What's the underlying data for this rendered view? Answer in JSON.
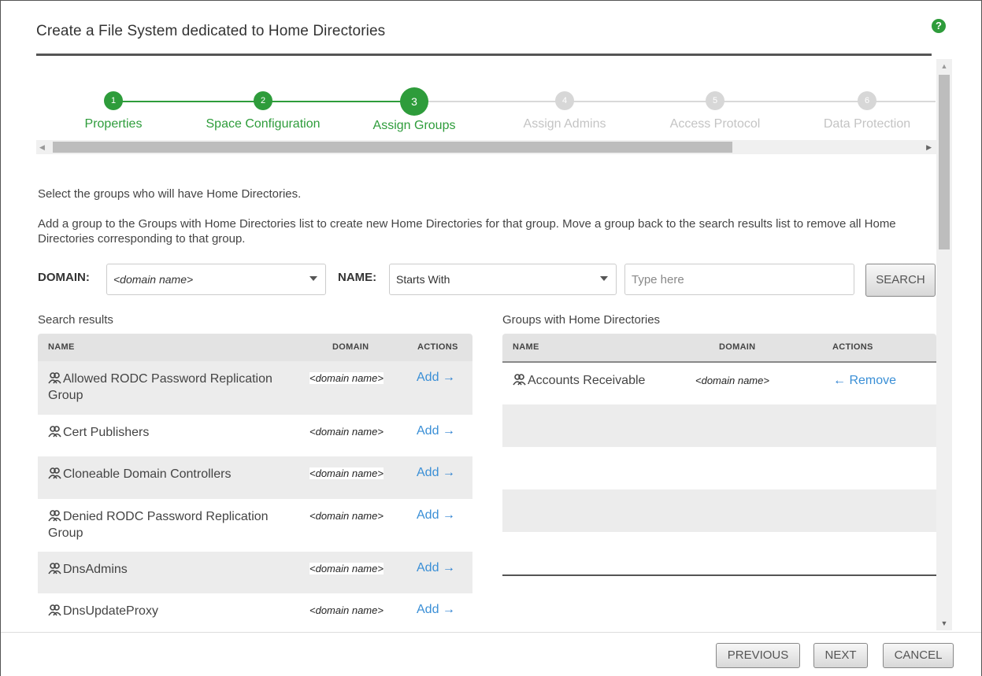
{
  "dialog": {
    "title": "Create a File System dedicated to Home Directories",
    "help_icon": "?"
  },
  "wizard": {
    "steps": [
      {
        "number": "1",
        "label": "Properties",
        "state": "done"
      },
      {
        "number": "2",
        "label": "Space Configuration",
        "state": "done"
      },
      {
        "number": "3",
        "label": "Assign Groups",
        "state": "current"
      },
      {
        "number": "4",
        "label": "Assign Admins",
        "state": "pending"
      },
      {
        "number": "5",
        "label": "Access Protocol",
        "state": "pending"
      },
      {
        "number": "6",
        "label": "Data Protection",
        "state": "pending"
      }
    ]
  },
  "instructions": {
    "line1": "Select the groups who will have Home Directories.",
    "line2": "Add a group to the Groups with Home Directories list to create new Home Directories for that group. Move a group back to the search results list to remove all Home Directories corresponding to that group."
  },
  "search": {
    "domain_label": "DOMAIN:",
    "domain_value": "<domain name>",
    "name_label": "NAME:",
    "name_mode": "Starts With",
    "query_placeholder": "Type here",
    "search_button": "SEARCH"
  },
  "search_results": {
    "title": "Search results",
    "columns": [
      "NAME",
      "DOMAIN",
      "ACTIONS"
    ],
    "rows": [
      {
        "name": "Allowed RODC Password Replication Group",
        "domain": "<domain name>",
        "action": "Add"
      },
      {
        "name": "Cert Publishers",
        "domain": "<domain name>",
        "action": "Add"
      },
      {
        "name": "Cloneable Domain Controllers",
        "domain": "<domain name>",
        "action": "Add"
      },
      {
        "name": "Denied RODC Password Replication Group",
        "domain": "<domain name>",
        "action": "Add"
      },
      {
        "name": "DnsAdmins",
        "domain": "<domain name>",
        "action": "Add"
      },
      {
        "name": "DnsUpdateProxy",
        "domain": "<domain name>",
        "action": "Add"
      }
    ]
  },
  "home_groups": {
    "title": "Groups with Home Directories",
    "columns": [
      "NAME",
      "DOMAIN",
      "ACTIONS"
    ],
    "rows": [
      {
        "name": "Accounts Receivable",
        "domain": "<domain name>",
        "action": "Remove"
      }
    ]
  },
  "footer": {
    "previous": "PREVIOUS",
    "next": "NEXT",
    "cancel": "CANCEL"
  },
  "colors": {
    "accent_green": "#2e9c3b",
    "link_blue": "#3a8fd6",
    "pending_grey": "#d7d7d7"
  }
}
